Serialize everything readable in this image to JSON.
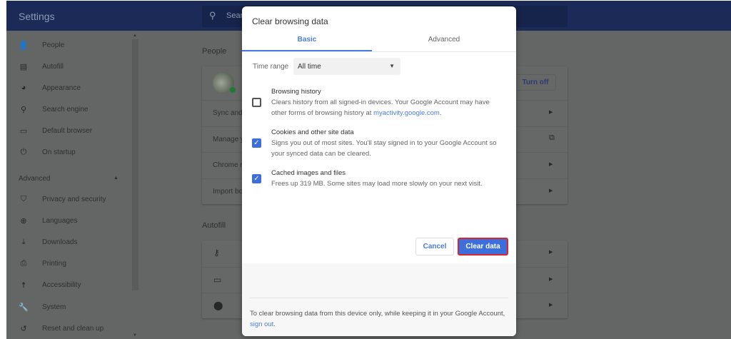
{
  "header": {
    "title": "Settings",
    "search_placeholder": "Search settings"
  },
  "sidebar": {
    "items": [
      {
        "label": "People",
        "icon": "person-icon",
        "glyph": "👤"
      },
      {
        "label": "Autofill",
        "icon": "clipboard-icon",
        "glyph": "▤"
      },
      {
        "label": "Appearance",
        "icon": "palette-icon",
        "glyph": "◕"
      },
      {
        "label": "Search engine",
        "icon": "search-icon",
        "glyph": "⚲"
      },
      {
        "label": "Default browser",
        "icon": "browser-icon",
        "glyph": "▭"
      },
      {
        "label": "On startup",
        "icon": "power-icon",
        "glyph": "⏻"
      }
    ],
    "advanced_label": "Advanced",
    "advanced_items": [
      {
        "label": "Privacy and security",
        "icon": "shield-icon",
        "glyph": "⛉"
      },
      {
        "label": "Languages",
        "icon": "globe-icon",
        "glyph": "⊕"
      },
      {
        "label": "Downloads",
        "icon": "download-icon",
        "glyph": "⤓"
      },
      {
        "label": "Printing",
        "icon": "printer-icon",
        "glyph": "⎙"
      },
      {
        "label": "Accessibility",
        "icon": "accessibility-icon",
        "glyph": "☨"
      },
      {
        "label": "System",
        "icon": "wrench-icon",
        "glyph": "🔧"
      },
      {
        "label": "Reset and clean up",
        "icon": "history-icon",
        "glyph": "↺"
      }
    ]
  },
  "main": {
    "people_heading": "People",
    "turn_off": "Turn off",
    "people_rows": [
      "Sync and Google services",
      "Manage your Google Account",
      "Chrome name and picture",
      "Import bookmarks and settings"
    ],
    "autofill_heading": "Autofill",
    "autofill_rows": [
      {
        "icon": "key-icon",
        "glyph": "⚷"
      },
      {
        "icon": "credit-card-icon",
        "glyph": "▭"
      },
      {
        "icon": "location-pin-icon",
        "glyph": "⬤"
      }
    ]
  },
  "dialog": {
    "title": "Clear browsing data",
    "tabs": [
      "Basic",
      "Advanced"
    ],
    "active_tab": "Basic",
    "time_range_label": "Time range",
    "time_range_value": "All time",
    "items": [
      {
        "title": "Browsing history",
        "desc": "Clears history from all signed-in devices. Your Google Account may have other forms of browsing history at ",
        "link": "myactivity.google.com",
        "desc_end": ".",
        "checked": false
      },
      {
        "title": "Cookies and other site data",
        "desc": "Signs you out of most sites. You'll stay signed in to your Google Account so your synced data can be cleared.",
        "checked": true
      },
      {
        "title": "Cached images and files",
        "desc": "Frees up 319 MB. Some sites may load more slowly on your next visit.",
        "checked": true
      }
    ],
    "cancel": "Cancel",
    "clear": "Clear data",
    "footer_text": "To clear browsing data from this device only, while keeping it in your Google Account, ",
    "footer_link": "sign out",
    "footer_end": ".",
    "colors": {
      "accent": "#3d6fdc",
      "highlight": "#d9262b"
    }
  }
}
